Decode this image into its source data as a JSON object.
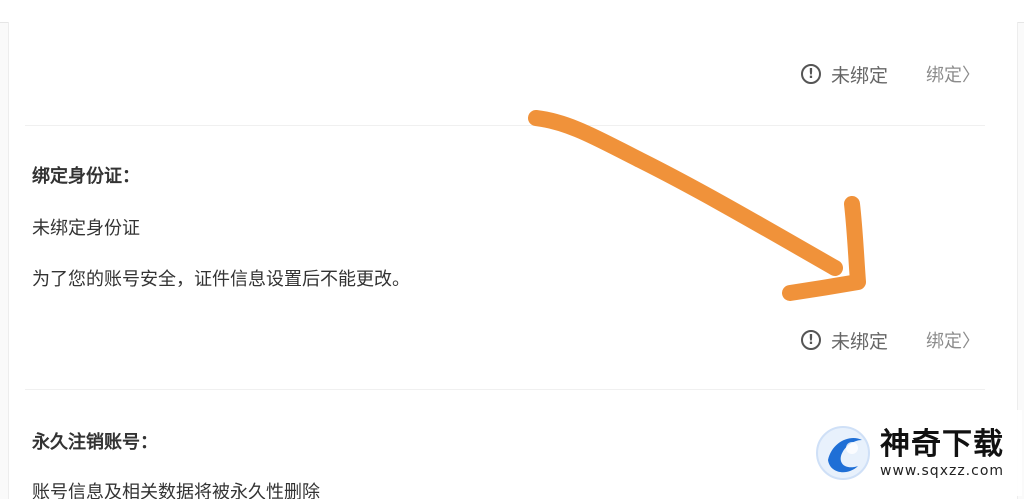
{
  "colors": {
    "arrow": "#f0923a",
    "logo_blue": "#1f6fd6",
    "text": "#333333",
    "muted": "#8c8c8c"
  },
  "top_row": {
    "status_icon": "warning-circle-icon",
    "status_text": "未绑定",
    "bind_label": "绑定〉"
  },
  "id_section": {
    "title": "绑定身份证：",
    "status_line": "未绑定身份证",
    "note": "为了您的账号安全，证件信息设置后不能更改。",
    "status_icon": "warning-circle-icon",
    "status_text": "未绑定",
    "bind_label": "绑定〉"
  },
  "delete_section": {
    "title": "永久注销账号：",
    "description": "账号信息及相关数据将被永久性删除"
  },
  "watermark": {
    "name": "神奇下载",
    "url": "www.sqxzz.com"
  }
}
